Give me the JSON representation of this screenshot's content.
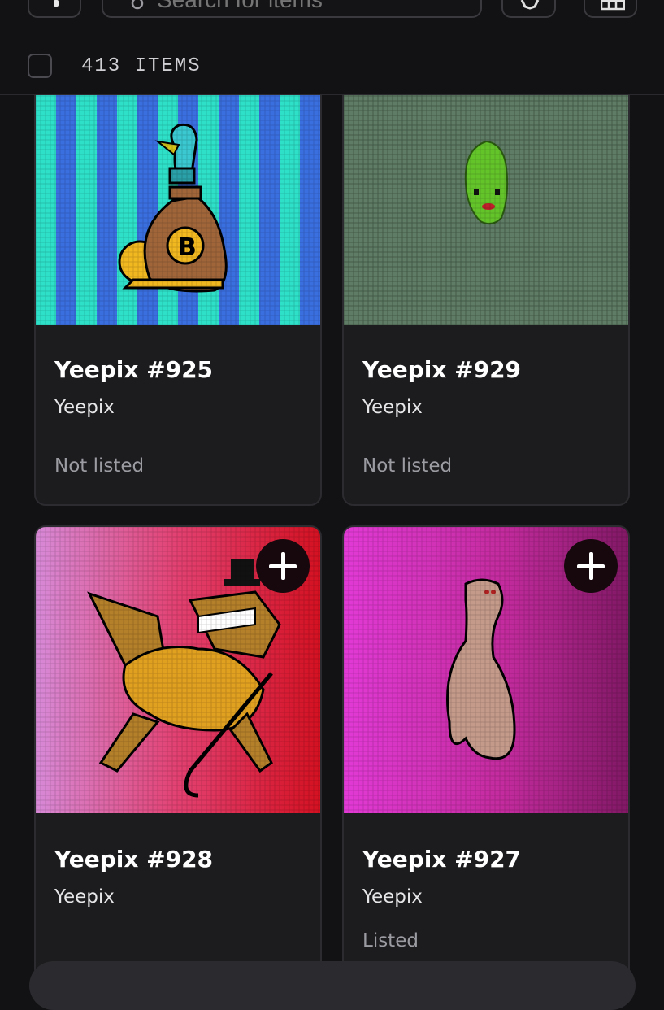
{
  "search": {
    "placeholder": "Search for items"
  },
  "header": {
    "item_count": "413 ITEMS"
  },
  "items": [
    {
      "name": "Yeepix #925",
      "collection": "Yeepix",
      "status": "Not listed"
    },
    {
      "name": "Yeepix #929",
      "collection": "Yeepix",
      "status": "Not listed"
    },
    {
      "name": "Yeepix #928",
      "collection": "Yeepix",
      "status": ""
    },
    {
      "name": "Yeepix #927",
      "collection": "Yeepix",
      "status": "Listed"
    }
  ],
  "colors": {
    "background": "#121214",
    "card": "#1c1c1f",
    "card_border": "#2c2c30",
    "text_muted": "#9b9ba2"
  },
  "icons": [
    "menu-icon",
    "search-icon",
    "settings-icon",
    "grid-view-icon",
    "plus-icon"
  ]
}
